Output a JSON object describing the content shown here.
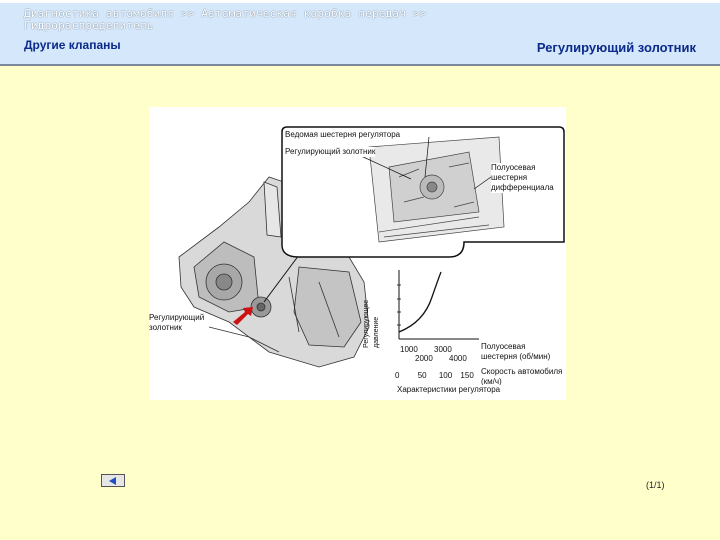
{
  "header": {
    "breadcrumb": "Диагностика автомобиля >> Автоматическая коробка передач >> Гидрораспределитель",
    "section": "Другие клапаны",
    "title": "Регулирующий золотник"
  },
  "figure": {
    "labels": {
      "driven_gear": "Ведомая шестерня регулятора",
      "valve_top": "Регулирующий золотник",
      "axle_gear": "Полуосевая шестерня дифференциала",
      "valve_left": "Регулирующий золотник",
      "y_axis": "Регулирующее давление",
      "x_ticks_top": [
        "1000",
        "3000"
      ],
      "x_ticks_mid": [
        "2000",
        "4000"
      ],
      "x_label_axle": "Полуосевая шестерня (об/мин)",
      "x_ticks_speed": [
        "0",
        "50",
        "100",
        "150"
      ],
      "x_label_speed": "Скорость автомобиля (км/ч)",
      "chart_caption": "Характеристики регулятора"
    }
  },
  "footer": {
    "page_counter": "(1/1)",
    "back_icon": "left-arrow-icon"
  },
  "colors": {
    "background": "#ffffcc",
    "header": "#d4e7fb",
    "title": "#0b2a8a",
    "arrow": "#cc1111"
  }
}
